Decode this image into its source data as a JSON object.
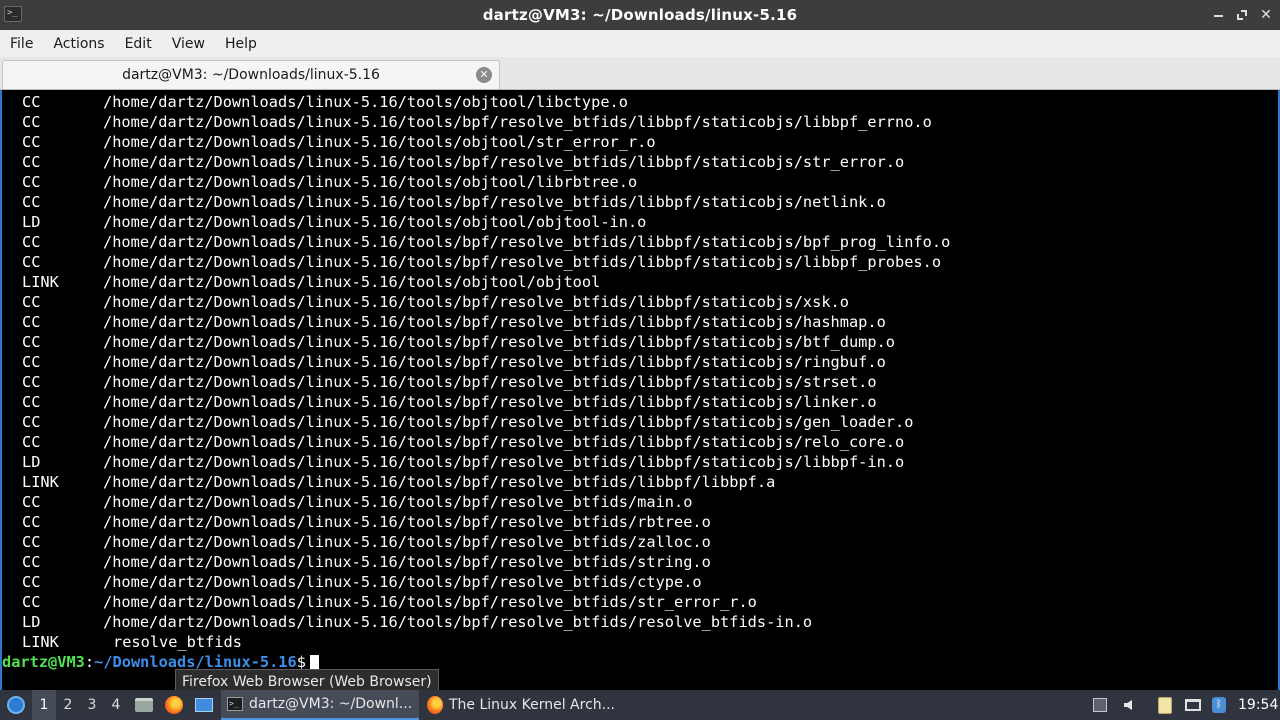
{
  "window": {
    "title": "dartz@VM3: ~/Downloads/linux-5.16",
    "app_icon": "terminal-icon",
    "controls": [
      "minimize-icon",
      "maximize-icon",
      "close-icon"
    ],
    "close_glyph": "✕"
  },
  "menubar": {
    "items": [
      "File",
      "Actions",
      "Edit",
      "View",
      "Help"
    ]
  },
  "tabs": [
    {
      "label": "dartz@VM3: ~/Downloads/linux-5.16",
      "close_glyph": "✕"
    }
  ],
  "terminal": {
    "lines": [
      {
        "tag": "CC",
        "path": "/home/dartz/Downloads/linux-5.16/tools/objtool/libctype.o"
      },
      {
        "tag": "CC",
        "path": "/home/dartz/Downloads/linux-5.16/tools/bpf/resolve_btfids/libbpf/staticobjs/libbpf_errno.o"
      },
      {
        "tag": "CC",
        "path": "/home/dartz/Downloads/linux-5.16/tools/objtool/str_error_r.o"
      },
      {
        "tag": "CC",
        "path": "/home/dartz/Downloads/linux-5.16/tools/bpf/resolve_btfids/libbpf/staticobjs/str_error.o"
      },
      {
        "tag": "CC",
        "path": "/home/dartz/Downloads/linux-5.16/tools/objtool/librbtree.o"
      },
      {
        "tag": "CC",
        "path": "/home/dartz/Downloads/linux-5.16/tools/bpf/resolve_btfids/libbpf/staticobjs/netlink.o"
      },
      {
        "tag": "LD",
        "path": "/home/dartz/Downloads/linux-5.16/tools/objtool/objtool-in.o"
      },
      {
        "tag": "CC",
        "path": "/home/dartz/Downloads/linux-5.16/tools/bpf/resolve_btfids/libbpf/staticobjs/bpf_prog_linfo.o"
      },
      {
        "tag": "CC",
        "path": "/home/dartz/Downloads/linux-5.16/tools/bpf/resolve_btfids/libbpf/staticobjs/libbpf_probes.o"
      },
      {
        "tag": "LINK",
        "path": "/home/dartz/Downloads/linux-5.16/tools/objtool/objtool"
      },
      {
        "tag": "CC",
        "path": "/home/dartz/Downloads/linux-5.16/tools/bpf/resolve_btfids/libbpf/staticobjs/xsk.o"
      },
      {
        "tag": "CC",
        "path": "/home/dartz/Downloads/linux-5.16/tools/bpf/resolve_btfids/libbpf/staticobjs/hashmap.o"
      },
      {
        "tag": "CC",
        "path": "/home/dartz/Downloads/linux-5.16/tools/bpf/resolve_btfids/libbpf/staticobjs/btf_dump.o"
      },
      {
        "tag": "CC",
        "path": "/home/dartz/Downloads/linux-5.16/tools/bpf/resolve_btfids/libbpf/staticobjs/ringbuf.o"
      },
      {
        "tag": "CC",
        "path": "/home/dartz/Downloads/linux-5.16/tools/bpf/resolve_btfids/libbpf/staticobjs/strset.o"
      },
      {
        "tag": "CC",
        "path": "/home/dartz/Downloads/linux-5.16/tools/bpf/resolve_btfids/libbpf/staticobjs/linker.o"
      },
      {
        "tag": "CC",
        "path": "/home/dartz/Downloads/linux-5.16/tools/bpf/resolve_btfids/libbpf/staticobjs/gen_loader.o"
      },
      {
        "tag": "CC",
        "path": "/home/dartz/Downloads/linux-5.16/tools/bpf/resolve_btfids/libbpf/staticobjs/relo_core.o"
      },
      {
        "tag": "LD",
        "path": "/home/dartz/Downloads/linux-5.16/tools/bpf/resolve_btfids/libbpf/staticobjs/libbpf-in.o"
      },
      {
        "tag": "LINK",
        "path": "/home/dartz/Downloads/linux-5.16/tools/bpf/resolve_btfids/libbpf/libbpf.a"
      },
      {
        "tag": "CC",
        "path": "/home/dartz/Downloads/linux-5.16/tools/bpf/resolve_btfids/main.o"
      },
      {
        "tag": "CC",
        "path": "/home/dartz/Downloads/linux-5.16/tools/bpf/resolve_btfids/rbtree.o"
      },
      {
        "tag": "CC",
        "path": "/home/dartz/Downloads/linux-5.16/tools/bpf/resolve_btfids/zalloc.o"
      },
      {
        "tag": "CC",
        "path": "/home/dartz/Downloads/linux-5.16/tools/bpf/resolve_btfids/string.o"
      },
      {
        "tag": "CC",
        "path": "/home/dartz/Downloads/linux-5.16/tools/bpf/resolve_btfids/ctype.o"
      },
      {
        "tag": "CC",
        "path": "/home/dartz/Downloads/linux-5.16/tools/bpf/resolve_btfids/str_error_r.o"
      },
      {
        "tag": "LD",
        "path": "/home/dartz/Downloads/linux-5.16/tools/bpf/resolve_btfids/resolve_btfids-in.o"
      },
      {
        "tag": "LINK",
        "path": "resolve_btfids",
        "indent": true
      }
    ],
    "prompt": {
      "user_host": "dartz@VM3",
      "separator": ":",
      "path": "~/Downloads/linux-5.16",
      "symbol": "$"
    },
    "colors": {
      "background": "#000000",
      "text": "#ffffff",
      "prompt_user": "#4fe24f",
      "prompt_path": "#3b8eea",
      "border_accent": "#2a78c7"
    }
  },
  "tooltip": {
    "text": "Firefox Web Browser (Web Browser)"
  },
  "taskbar": {
    "start_icon": "menu-globe-icon",
    "workspaces": [
      "1",
      "2",
      "3",
      "4"
    ],
    "active_workspace": "1",
    "launchers": [
      "file-manager-icon",
      "firefox-icon",
      "show-desktop-icon"
    ],
    "tasks": [
      {
        "label": "dartz@VM3: ~/Downl...",
        "icon": "terminal-icon",
        "active": true
      },
      {
        "label": "The Linux Kernel Arch...",
        "icon": "firefox-icon",
        "active": false
      }
    ],
    "tray_icons": [
      "updates-icon",
      "volume-icon",
      "clipboard-icon",
      "network-icon",
      "bluetooth-icon"
    ],
    "bluetooth_glyph": "ᛒ",
    "clock": "19:54",
    "colors": {
      "background": "#2f343f",
      "active_accent": "#5294e2"
    }
  }
}
